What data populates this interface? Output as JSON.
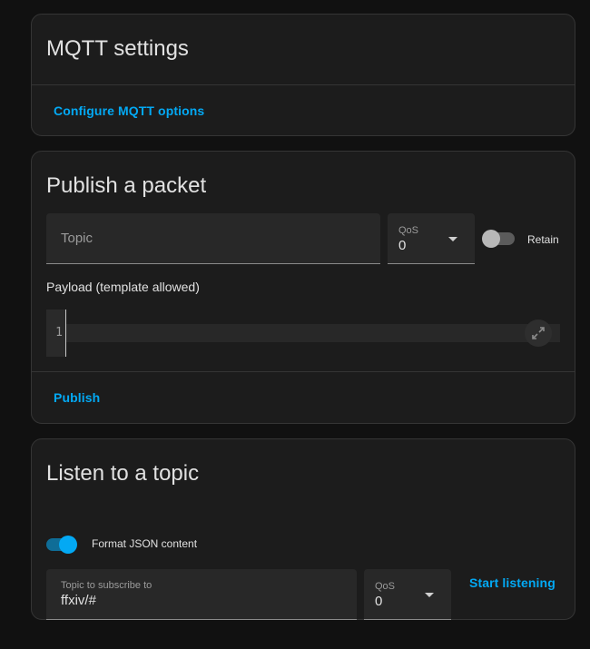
{
  "mqtt_settings": {
    "title": "MQTT settings",
    "configure_label": "Configure MQTT options"
  },
  "publish": {
    "title": "Publish a packet",
    "topic_placeholder": "Topic",
    "qos_label": "QoS",
    "qos_value": "0",
    "retain_label": "Retain",
    "retain_on": false,
    "payload_label": "Payload (template allowed)",
    "editor_line_number": "1",
    "publish_label": "Publish"
  },
  "listen": {
    "title": "Listen to a topic",
    "format_json_label": "Format JSON content",
    "format_json_on": true,
    "topic_label": "Topic to subscribe to",
    "topic_value": "ffxiv/#",
    "qos_label": "QoS",
    "qos_value": "0",
    "start_label": "Start listening"
  },
  "colors": {
    "accent": "#03a9f4",
    "background": "#111111",
    "card": "#1c1c1c",
    "field": "#282828"
  }
}
